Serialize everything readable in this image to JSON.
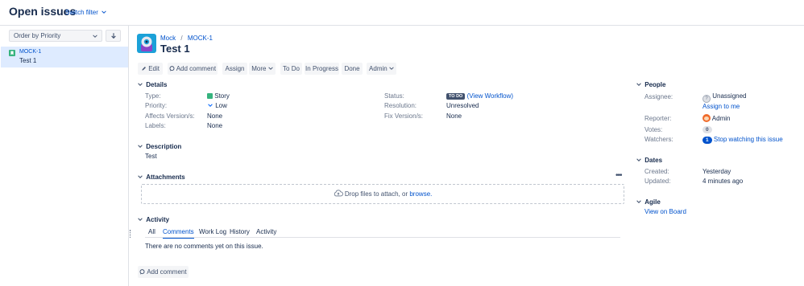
{
  "header": {
    "title": "Open issues",
    "switch_filter": "Switch filter"
  },
  "sidebar": {
    "order_label": "Order by Priority",
    "items": [
      {
        "key": "MOCK-1",
        "summary": "Test 1"
      }
    ]
  },
  "issue": {
    "breadcrumb_project": "Mock",
    "breadcrumb_sep": "/",
    "breadcrumb_key": "MOCK-1",
    "title": "Test 1"
  },
  "toolbar": {
    "edit": "Edit",
    "add_comment": "Add comment",
    "assign": "Assign",
    "more": "More",
    "todo": "To Do",
    "in_progress": "In Progress",
    "done": "Done",
    "admin": "Admin"
  },
  "details": {
    "heading": "Details",
    "type_label": "Type:",
    "type_value": "Story",
    "priority_label": "Priority:",
    "priority_value": "Low",
    "affects_label": "Affects Version/s:",
    "affects_value": "None",
    "labels_label": "Labels:",
    "labels_value": "None",
    "status_label": "Status:",
    "status_value": "TO DO",
    "status_workflow": "(View Workflow)",
    "resolution_label": "Resolution:",
    "resolution_value": "Unresolved",
    "fix_label": "Fix Version/s:",
    "fix_value": "None"
  },
  "description": {
    "heading": "Description",
    "text": "Test"
  },
  "attachments": {
    "heading": "Attachments",
    "drop_text": "Drop files to attach, or",
    "browse": "browse."
  },
  "activity": {
    "heading": "Activity",
    "tabs": [
      "All",
      "Comments",
      "Work Log",
      "History",
      "Activity"
    ],
    "active_tab": "Comments",
    "empty_text": "There are no comments yet on this issue.",
    "add_comment": "Add comment"
  },
  "people": {
    "heading": "People",
    "assignee_label": "Assignee:",
    "assignee_value": "Unassigned",
    "assign_to_me": "Assign to me",
    "reporter_label": "Reporter:",
    "reporter_value": "Admin",
    "votes_label": "Votes:",
    "votes_value": "0",
    "watchers_label": "Watchers:",
    "watchers_count": "1",
    "watchers_text": "Stop watching this issue"
  },
  "dates": {
    "heading": "Dates",
    "created_label": "Created:",
    "created_value": "Yesterday",
    "updated_label": "Updated:",
    "updated_value": "4 minutes ago"
  },
  "agile": {
    "heading": "Agile",
    "view_on_board": "View on Board"
  },
  "colors": {
    "link": "#0052cc",
    "story_green": "#36b37e",
    "status_badge": "#42526e",
    "selected_row": "#deebff"
  }
}
